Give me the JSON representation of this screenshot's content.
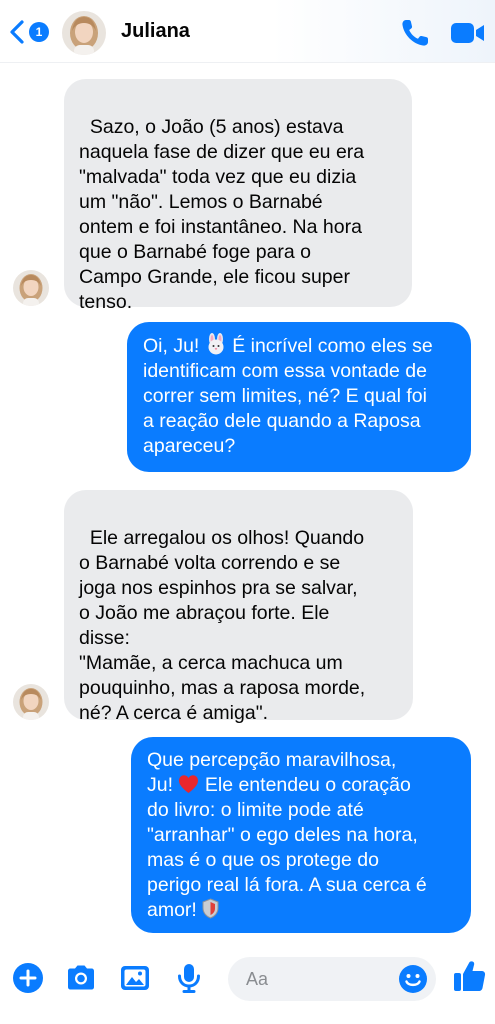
{
  "header": {
    "back_badge": "1",
    "contact_name": "Juliana"
  },
  "messages": [
    {
      "direction": "incoming",
      "text": "Sazo, o João (5 anos) estava\nnaquela fase de dizer que eu era\n\"malvada\" toda vez que eu dizia\num \"não\". Lemos o Barnabé\nontem e foi instantâneo. Na hora\nque o Barnabé foge para o\nCampo Grande, ele ficou super\ntenso."
    },
    {
      "direction": "outgoing",
      "text_before_emoji": "Oi, Ju! ",
      "emoji": "rabbit-face-emoji",
      "text_after_emoji": " É incrível como eles se\nidentificam com essa vontade de\ncorrer sem limites, né? E qual foi\na reação dele quando a Raposa\napareceu?"
    },
    {
      "direction": "incoming",
      "text": "Ele arregalou os olhos! Quando\no Barnabé volta correndo e se\njoga nos espinhos pra se salvar,\no João me abraçou forte. Ele\ndisse:\n\"Mamãe, a cerca machuca um\npouquinho, mas a raposa morde,\nné? A cerca é amiga\"."
    },
    {
      "direction": "outgoing",
      "text_before_emoji": "Que percepção maravilhosa,\nJu! ",
      "emoji": "red-heart-emoji",
      "text_after_emoji": " Ele entendeu o coração\ndo livro: o limite pode até\n\"arranhar\" o ego deles na hora,\nmas é o que os protege do\nperigo real lá fora. A sua cerca é\namor! ",
      "trailing_emoji": "shield-emoji"
    }
  ],
  "composer": {
    "placeholder": "Aa"
  },
  "colors": {
    "accent": "#0a7cff",
    "incoming_bubble": "#eaebed",
    "outgoing_bubble": "#0a7cff"
  }
}
